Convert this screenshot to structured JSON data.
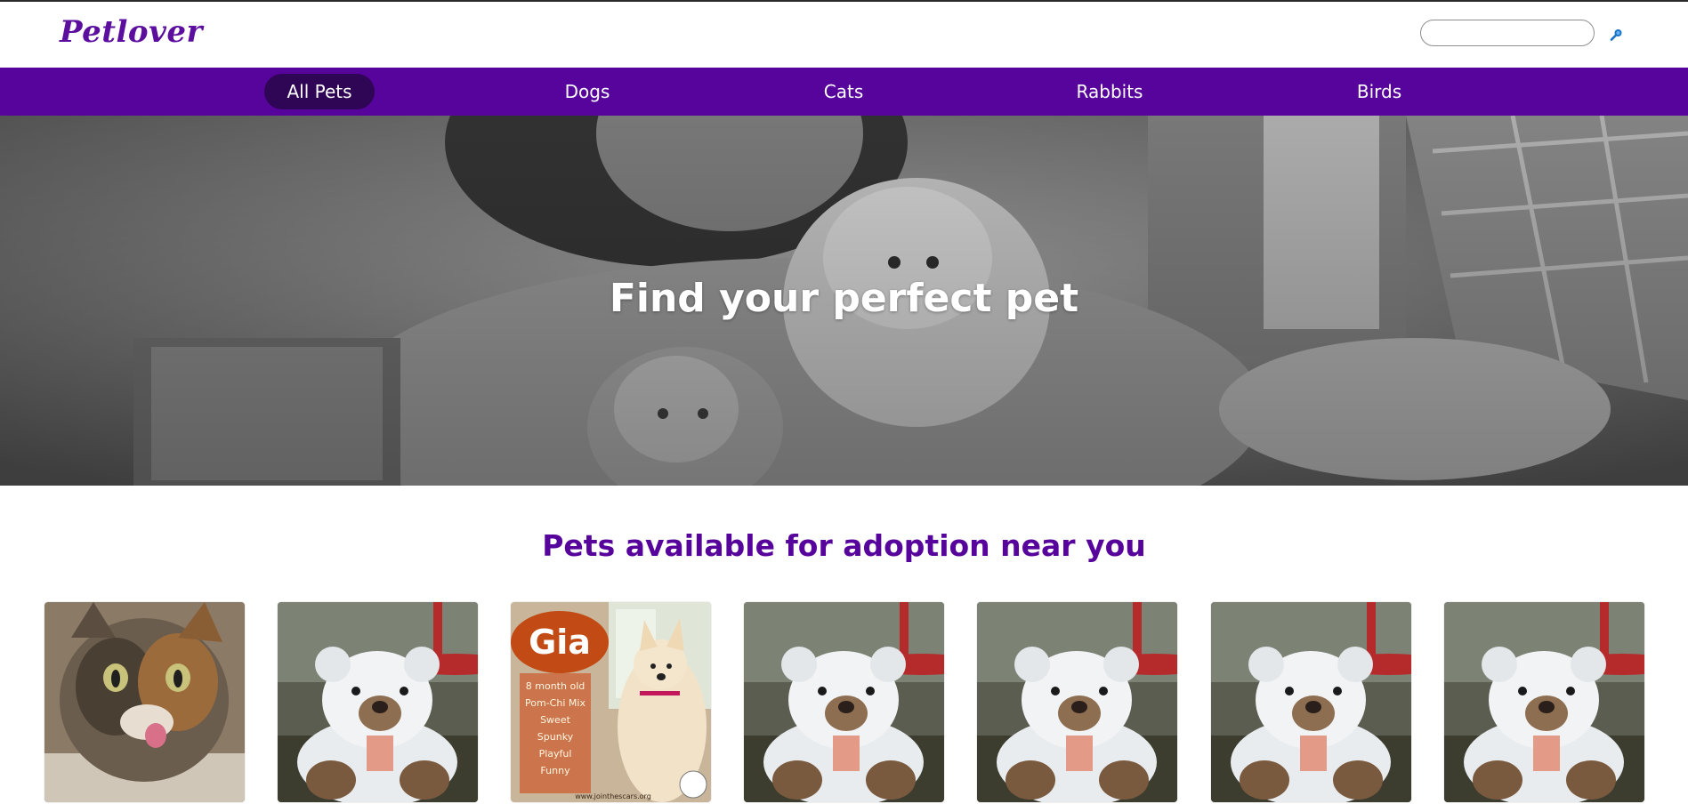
{
  "header": {
    "logo_text": "Petlover",
    "search": {
      "value": "",
      "placeholder": ""
    },
    "search_icon": "search-icon"
  },
  "nav": {
    "items": [
      {
        "label": "All Pets",
        "active": true
      },
      {
        "label": "Dogs",
        "active": false
      },
      {
        "label": "Cats",
        "active": false
      },
      {
        "label": "Rabbits",
        "active": false
      },
      {
        "label": "Birds",
        "active": false
      }
    ]
  },
  "hero": {
    "title": "Find your perfect pet"
  },
  "section": {
    "title": "Pets available for adoption near you"
  },
  "pets": [
    {
      "image": "cat-photo"
    },
    {
      "image": "teddy-bear-photo"
    },
    {
      "image": "gia-dog-poster",
      "poster": {
        "name": "Gia",
        "lines": [
          "8 month old",
          "Pom-Chi Mix",
          "Sweet",
          "Spunky",
          "Playful",
          "Funny"
        ],
        "url": "www.jointhescars.org"
      }
    },
    {
      "image": "teddy-bear-photo"
    },
    {
      "image": "teddy-bear-photo"
    },
    {
      "image": "teddy-bear-photo"
    },
    {
      "image": "teddy-bear-photo"
    }
  ],
  "colors": {
    "brand_purple": "#56049b",
    "nav_active": "#2f0556",
    "logo": "#5c0f9e"
  }
}
